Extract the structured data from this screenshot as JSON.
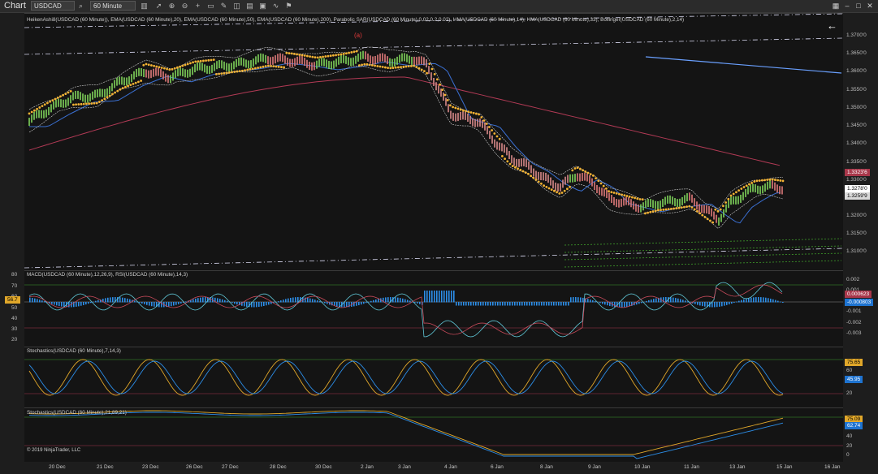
{
  "toolbar": {
    "chart_label": "Chart",
    "instrument": "USDCAD",
    "period": "60 Minute"
  },
  "icons": [
    "search-icon",
    "cursor-icon",
    "zoom-in-icon",
    "zoom-out-icon",
    "crosshair-icon",
    "properties-icon",
    "draw-icon",
    "ruler-icon",
    "chart-style-icon",
    "template-icon",
    "indicator-icon",
    "strategy-icon",
    "menu-icon"
  ],
  "price_panel": {
    "title": "HeikenAshi8(USDCAD (60 Minute)), EMA(USDCAD (60 Minute),20), EMA(USDCAD (60 Minute),50), EMA(USDCAD (60 Minute),200), Parabolic SAR(USDCAD (60 Minute),0.02,0.2,0.02), HMA(USDCAD (60 Minute),14), HMA(USDCAD (60 Minute),33), Bollinger(USDCAD (60 Minute),2,14)",
    "annotation": "(a)",
    "axis": [
      "1.3700'0",
      "1.3650'0",
      "1.3600'0",
      "1.3550'0",
      "1.3500'0",
      "1.3450'0",
      "1.3400'0",
      "1.3350'0",
      "1.3300'0",
      "1.3250'0",
      "1.3200'0",
      "1.3150'0",
      "1.3100'0"
    ],
    "tags": [
      {
        "text": "1.3323'6",
        "bg": "#a8374a",
        "fg": "#ffffff"
      },
      {
        "text": "1.3278'0",
        "bg": "#ffffff",
        "fg": "#000000"
      },
      {
        "text": "1.3259'9",
        "bg": "#d9d9d9",
        "fg": "#000000"
      }
    ]
  },
  "macd_panel": {
    "title": "MACD(USDCAD (60 Minute),12,26,9), RSI(USDCAD (60 Minute),14,3)",
    "left_axis": [
      "80",
      "70",
      "60",
      "50",
      "40",
      "30",
      "20"
    ],
    "right_axis": [
      "0.002",
      "0.001",
      "-0.001",
      "-0.002",
      "-0.003"
    ],
    "left_tag": "56.7",
    "tags": [
      {
        "text": "0.000623",
        "bg": "#a8374a",
        "fg": "#ffffff"
      },
      {
        "text": "-0.000803",
        "bg": "#1e73d0",
        "fg": "#ffffff"
      }
    ]
  },
  "stoch1_panel": {
    "title": "Stochastics(USDCAD (60 Minute),7,14,3)",
    "axis": [
      "60",
      "40",
      "20"
    ],
    "tags": [
      {
        "text": "75.65",
        "bg": "#e0a72a",
        "fg": "#000000"
      },
      {
        "text": "45.95",
        "bg": "#1e73d0",
        "fg": "#ffffff"
      }
    ]
  },
  "stoch2_panel": {
    "title": "Stochastics(USDCAD (60 Minute),21,89,21)",
    "copyright": "© 2019 NinjaTrader, LLC",
    "axis": [
      "60",
      "40",
      "20",
      "0"
    ],
    "tags": [
      {
        "text": "75.09",
        "bg": "#e0a72a",
        "fg": "#000000"
      },
      {
        "text": "62.74",
        "bg": "#1e73d0",
        "fg": "#ffffff"
      }
    ]
  },
  "x_axis": [
    "20 Dec",
    "21 Dec",
    "23 Dec",
    "26 Dec",
    "27 Dec",
    "28 Dec",
    "30 Dec",
    "2 Jan",
    "3 Jan",
    "4 Jan",
    "6 Jan",
    "8 Jan",
    "9 Jan",
    "10 Jan",
    "11 Jan",
    "13 Jan",
    "15 Jan",
    "16 Jan"
  ],
  "colors": {
    "background": "#141414",
    "sar": "#f2b233",
    "ema200": "#b23a55",
    "ema50": "#3a6fd1",
    "bollinger": "#cfcfcf",
    "trendline": "#d8d8f0",
    "blue_line": "#6aa0ff",
    "green_lines": "#3f9d2a"
  }
}
